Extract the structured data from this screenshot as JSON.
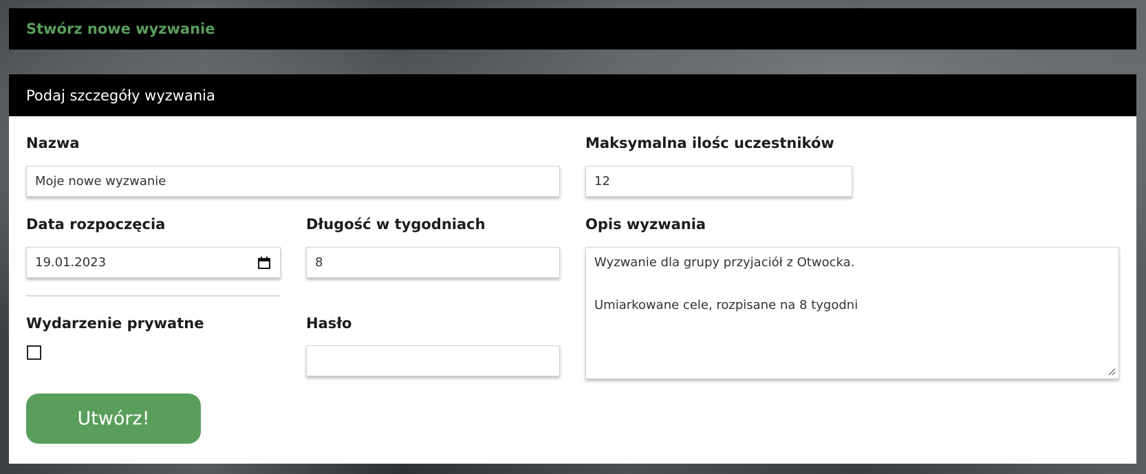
{
  "header": {
    "title": "Stwórz nowe wyzwanie"
  },
  "card": {
    "title": "Podaj szczegóły wyzwania",
    "fields": {
      "name": {
        "label": "Nazwa",
        "value": "Moje nowe wyzwanie"
      },
      "max_participants": {
        "label": "Maksymalna ilośc uczestników",
        "value": "12"
      },
      "start_date": {
        "label": "Data rozpoczęcia",
        "value": "19.01.2023"
      },
      "duration_weeks": {
        "label": "Długość w tygodniach",
        "value": "8"
      },
      "description": {
        "label": "Opis wyzwania",
        "value": "Wyzwanie dla grupy przyjaciół z Otwocka.\n\nUmiarkowane cele, rozpisane na 8 tygodni"
      },
      "private_event": {
        "label": "Wydarzenie prywatne",
        "checked": false
      },
      "password": {
        "label": "Hasło",
        "value": ""
      }
    },
    "submit_label": "Utwórz!"
  },
  "colors": {
    "accent": "#5a9e5c",
    "header_bg": "#000000"
  },
  "icons": {
    "date_picker": "calendar-icon",
    "resize": "resize-handle-icon"
  }
}
